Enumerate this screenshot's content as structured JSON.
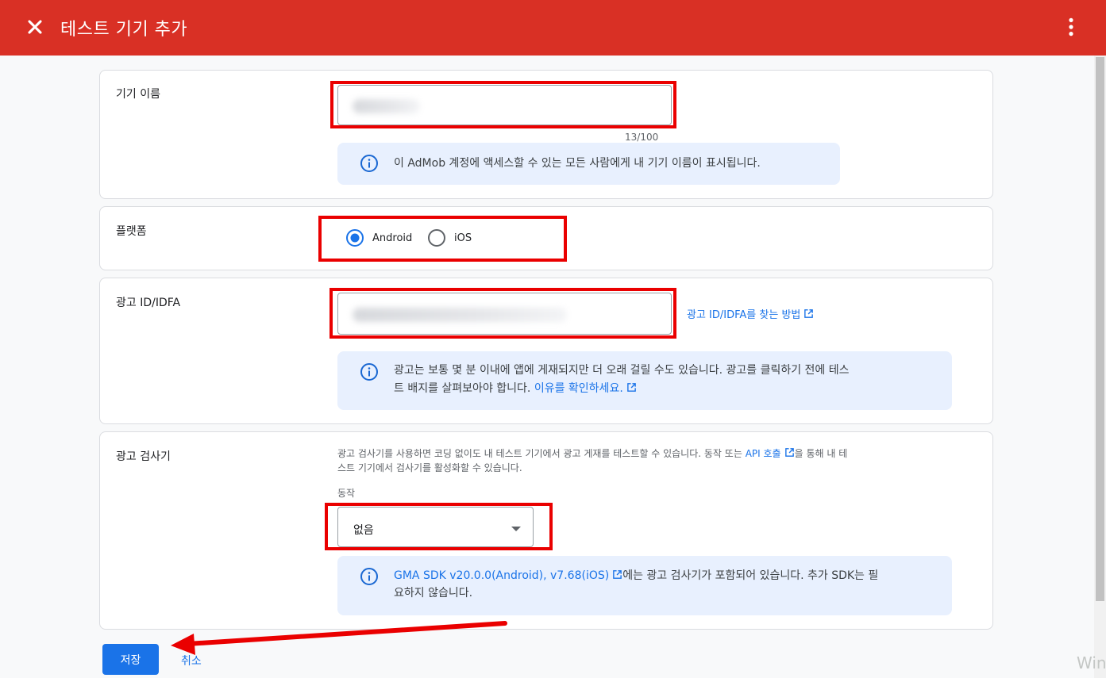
{
  "header": {
    "title": "테스트 기기 추가"
  },
  "device_name": {
    "label": "기기 이름",
    "counter": "13/100",
    "info": "이 AdMob 계정에 액세스할 수 있는 모든 사람에게 내 기기 이름이 표시됩니다."
  },
  "platform": {
    "label": "플랫폼",
    "options": [
      "Android",
      "iOS"
    ],
    "selected": "Android"
  },
  "ad_id": {
    "label": "광고 ID/IDFA",
    "help_link": "광고 ID/IDFA를 찾는 방법",
    "info_line1": "광고는 보통 몇 분 이내에 앱에 게재되지만 더 오래 걸릴 수도 있습니다. 광고를 클릭하기 전에 테스",
    "info_line2_prefix": "트 배지를 살펴보아야 합니다.",
    "info_link": "이유를 확인하세요."
  },
  "ad_inspector": {
    "label": "광고 검사기",
    "help_line1_prefix": "광고 검사기를 사용하면 코딩 없이도 내 테스트 기기에서 광고 게재를 테스트할 수 있습니다. 동작 또는",
    "help_link": "API 호출",
    "help_line1_suffix": "을 통해 내 테",
    "help_line2": "스트 기기에서 검사기를 활성화할 수 있습니다.",
    "action_label": "동작",
    "action_value": "없음",
    "info_link": "GMA SDK v20.0.0(Android), v7.68(iOS)",
    "info_line1_suffix": "에는 광고 검사기가 포함되어 있습니다. 추가 SDK는 필",
    "info_line2": "요하지 않습니다."
  },
  "footer": {
    "save": "저장",
    "cancel": "취소"
  },
  "watermark": "Win",
  "colors": {
    "header": "#d93025",
    "primary": "#1a73e8",
    "info_bg": "#e8f0fe",
    "annotation": "#ea0000"
  }
}
